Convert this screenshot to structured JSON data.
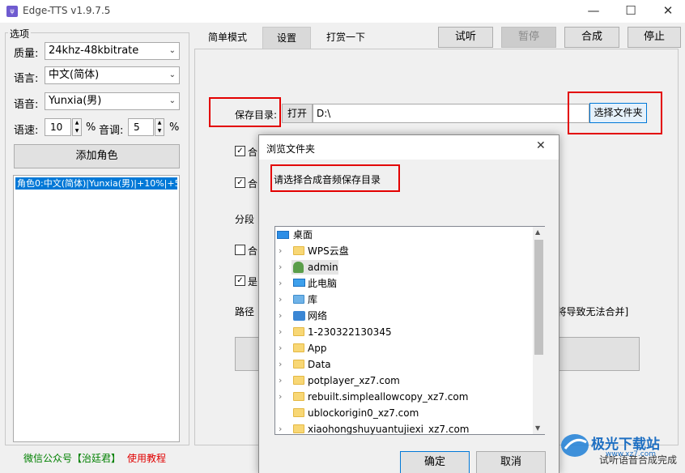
{
  "window": {
    "title": "Edge-TTS v1.9.7.5",
    "icon_text": "ψ"
  },
  "options": {
    "group_label": "选项",
    "quality_label": "质量:",
    "quality_value": "24khz-48kbitrate",
    "language_label": "语言:",
    "language_value": "中文(简体)",
    "voice_label": "语音:",
    "voice_value": "Yunxia(男)",
    "speed_label": "语速:",
    "speed_value": "10",
    "percent1": "%",
    "pitch_label": "音调:",
    "pitch_value": "5",
    "percent2": "%",
    "add_role": "添加角色",
    "role_item": "角色0:中文(简体)|Yunxia(男)|+10%|+5%"
  },
  "tabs": [
    {
      "label": "简单模式"
    },
    {
      "label": "设置"
    },
    {
      "label": "打赏一下"
    }
  ],
  "toolbar": {
    "preview": "试听",
    "pause": "暂停",
    "synthesize": "合成",
    "stop": "停止"
  },
  "settings": {
    "save_dir_label": "保存目录:",
    "open_button": "打开",
    "path_value": "D:\\",
    "choose_folder": "选择文件夹",
    "partial_1": "合",
    "partial_2": "合",
    "partial_3": "分段",
    "partial_4": "合",
    "partial_5": "是",
    "partial_6": "路径",
    "partial_7": "],将导致无法合并]"
  },
  "dialog": {
    "title": "浏览文件夹",
    "prompt": "请选择合成音频保存目录",
    "tree": [
      {
        "label": "桌面"
      },
      {
        "label": "WPS云盘"
      },
      {
        "label": "admin"
      },
      {
        "label": "此电脑"
      },
      {
        "label": "库"
      },
      {
        "label": "网络"
      },
      {
        "label": "1-230322130345"
      },
      {
        "label": "App"
      },
      {
        "label": "Data"
      },
      {
        "label": "potplayer_xz7.com"
      },
      {
        "label": "rebuilt.simpleallowcopy_xz7.com"
      },
      {
        "label": "ublockorigin0_xz7.com"
      },
      {
        "label": "xiaohongshuyuantujiexi_xz7.com"
      }
    ],
    "ok": "确定",
    "cancel": "取消"
  },
  "footer": {
    "wechat": "微信公众号【治廷君】",
    "tutorial": "使用教程",
    "status": "试听语音合成完成"
  },
  "watermark": {
    "text": "极光下载站",
    "url": "www.xz7.com"
  },
  "colors": {
    "accent_red": "#e30000",
    "selection_blue": "#0078d7",
    "link_green": "#008000",
    "folder_yellow": "#f8d775"
  }
}
